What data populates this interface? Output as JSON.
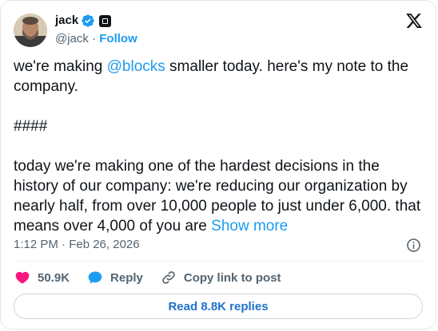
{
  "author": {
    "name": "jack",
    "handle": "@jack",
    "separator": "·",
    "follow_label": "Follow",
    "verified_icon": "verified-badge-icon",
    "affiliation_icon": "block-affiliate-badge-icon",
    "avatar": "profile-avatar"
  },
  "brand": {
    "logo_icon": "x-logo-icon"
  },
  "tweet": {
    "line1_prefix": "we're making ",
    "mention": "@blocks",
    "line1_suffix": " smaller today. here's my note to the company.",
    "separator_text": "####",
    "paragraph": "today we're making one of the hardest decisions in the history of our company: we're reducing our organization by nearly half, from over 10,000 people to just under 6,000. that means over 4,000 of you are",
    "show_more": "Show more",
    "timestamp": "1:12 PM · Feb 26, 2026",
    "info_icon": "info-icon"
  },
  "actions": {
    "like_count": "50.9K",
    "reply_label": "Reply",
    "copy_link_label": "Copy link to post"
  },
  "footer": {
    "read_replies_label": "Read 8.8K replies"
  },
  "colors": {
    "accent": "#1d9bf0",
    "like": "#f91880",
    "text": "#0f1419",
    "muted": "#536471"
  }
}
